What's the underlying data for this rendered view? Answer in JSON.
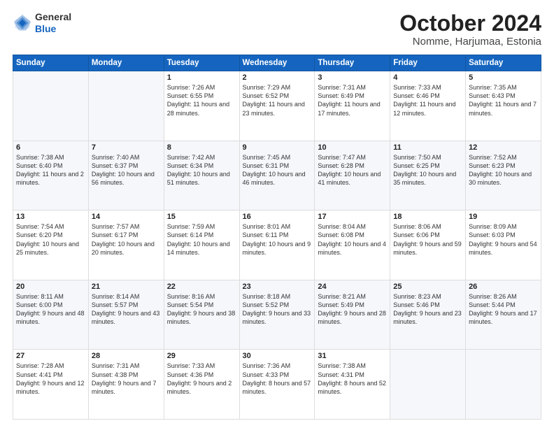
{
  "logo": {
    "text_general": "General",
    "text_blue": "Blue"
  },
  "header": {
    "month": "October 2024",
    "location": "Nomme, Harjumaa, Estonia"
  },
  "days_of_week": [
    "Sunday",
    "Monday",
    "Tuesday",
    "Wednesday",
    "Thursday",
    "Friday",
    "Saturday"
  ],
  "weeks": [
    [
      {
        "day": "",
        "info": ""
      },
      {
        "day": "",
        "info": ""
      },
      {
        "day": "1",
        "info": "Sunrise: 7:26 AM\nSunset: 6:55 PM\nDaylight: 11 hours and 28 minutes."
      },
      {
        "day": "2",
        "info": "Sunrise: 7:29 AM\nSunset: 6:52 PM\nDaylight: 11 hours and 23 minutes."
      },
      {
        "day": "3",
        "info": "Sunrise: 7:31 AM\nSunset: 6:49 PM\nDaylight: 11 hours and 17 minutes."
      },
      {
        "day": "4",
        "info": "Sunrise: 7:33 AM\nSunset: 6:46 PM\nDaylight: 11 hours and 12 minutes."
      },
      {
        "day": "5",
        "info": "Sunrise: 7:35 AM\nSunset: 6:43 PM\nDaylight: 11 hours and 7 minutes."
      }
    ],
    [
      {
        "day": "6",
        "info": "Sunrise: 7:38 AM\nSunset: 6:40 PM\nDaylight: 11 hours and 2 minutes."
      },
      {
        "day": "7",
        "info": "Sunrise: 7:40 AM\nSunset: 6:37 PM\nDaylight: 10 hours and 56 minutes."
      },
      {
        "day": "8",
        "info": "Sunrise: 7:42 AM\nSunset: 6:34 PM\nDaylight: 10 hours and 51 minutes."
      },
      {
        "day": "9",
        "info": "Sunrise: 7:45 AM\nSunset: 6:31 PM\nDaylight: 10 hours and 46 minutes."
      },
      {
        "day": "10",
        "info": "Sunrise: 7:47 AM\nSunset: 6:28 PM\nDaylight: 10 hours and 41 minutes."
      },
      {
        "day": "11",
        "info": "Sunrise: 7:50 AM\nSunset: 6:25 PM\nDaylight: 10 hours and 35 minutes."
      },
      {
        "day": "12",
        "info": "Sunrise: 7:52 AM\nSunset: 6:23 PM\nDaylight: 10 hours and 30 minutes."
      }
    ],
    [
      {
        "day": "13",
        "info": "Sunrise: 7:54 AM\nSunset: 6:20 PM\nDaylight: 10 hours and 25 minutes."
      },
      {
        "day": "14",
        "info": "Sunrise: 7:57 AM\nSunset: 6:17 PM\nDaylight: 10 hours and 20 minutes."
      },
      {
        "day": "15",
        "info": "Sunrise: 7:59 AM\nSunset: 6:14 PM\nDaylight: 10 hours and 14 minutes."
      },
      {
        "day": "16",
        "info": "Sunrise: 8:01 AM\nSunset: 6:11 PM\nDaylight: 10 hours and 9 minutes."
      },
      {
        "day": "17",
        "info": "Sunrise: 8:04 AM\nSunset: 6:08 PM\nDaylight: 10 hours and 4 minutes."
      },
      {
        "day": "18",
        "info": "Sunrise: 8:06 AM\nSunset: 6:06 PM\nDaylight: 9 hours and 59 minutes."
      },
      {
        "day": "19",
        "info": "Sunrise: 8:09 AM\nSunset: 6:03 PM\nDaylight: 9 hours and 54 minutes."
      }
    ],
    [
      {
        "day": "20",
        "info": "Sunrise: 8:11 AM\nSunset: 6:00 PM\nDaylight: 9 hours and 48 minutes."
      },
      {
        "day": "21",
        "info": "Sunrise: 8:14 AM\nSunset: 5:57 PM\nDaylight: 9 hours and 43 minutes."
      },
      {
        "day": "22",
        "info": "Sunrise: 8:16 AM\nSunset: 5:54 PM\nDaylight: 9 hours and 38 minutes."
      },
      {
        "day": "23",
        "info": "Sunrise: 8:18 AM\nSunset: 5:52 PM\nDaylight: 9 hours and 33 minutes."
      },
      {
        "day": "24",
        "info": "Sunrise: 8:21 AM\nSunset: 5:49 PM\nDaylight: 9 hours and 28 minutes."
      },
      {
        "day": "25",
        "info": "Sunrise: 8:23 AM\nSunset: 5:46 PM\nDaylight: 9 hours and 23 minutes."
      },
      {
        "day": "26",
        "info": "Sunrise: 8:26 AM\nSunset: 5:44 PM\nDaylight: 9 hours and 17 minutes."
      }
    ],
    [
      {
        "day": "27",
        "info": "Sunrise: 7:28 AM\nSunset: 4:41 PM\nDaylight: 9 hours and 12 minutes."
      },
      {
        "day": "28",
        "info": "Sunrise: 7:31 AM\nSunset: 4:38 PM\nDaylight: 9 hours and 7 minutes."
      },
      {
        "day": "29",
        "info": "Sunrise: 7:33 AM\nSunset: 4:36 PM\nDaylight: 9 hours and 2 minutes."
      },
      {
        "day": "30",
        "info": "Sunrise: 7:36 AM\nSunset: 4:33 PM\nDaylight: 8 hours and 57 minutes."
      },
      {
        "day": "31",
        "info": "Sunrise: 7:38 AM\nSunset: 4:31 PM\nDaylight: 8 hours and 52 minutes."
      },
      {
        "day": "",
        "info": ""
      },
      {
        "day": "",
        "info": ""
      }
    ]
  ]
}
